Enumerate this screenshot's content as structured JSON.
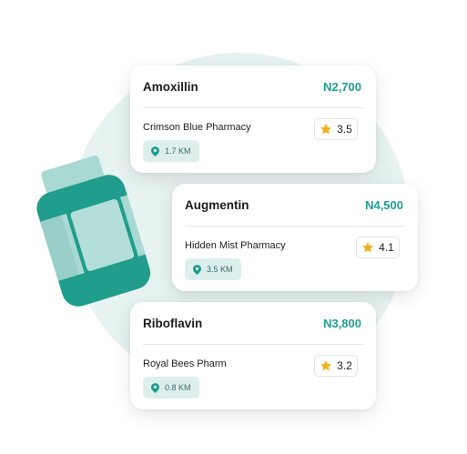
{
  "colors": {
    "accent": "#1f9e8e",
    "bottle_dark": "#209d8c",
    "bottle_light": "#a9d9d3",
    "star": "#f2b01e"
  },
  "cards": [
    {
      "name": "Amoxillin",
      "price": "N2,700",
      "pharmacy": "Crimson Blue Pharmacy",
      "rating": "3.5",
      "distance": "1.7 KM"
    },
    {
      "name": "Augmentin",
      "price": "N4,500",
      "pharmacy": "Hidden Mist Pharmacy",
      "rating": "4.1",
      "distance": "3.5 KM"
    },
    {
      "name": "Riboflavin",
      "price": "N3,800",
      "pharmacy": "Royal Bees Pharm",
      "rating": "3.2",
      "distance": "0.8 KM"
    }
  ],
  "icons": {
    "location": "map-pin-icon",
    "rating": "star-icon",
    "illustration": "medicine-bottle-icon"
  }
}
